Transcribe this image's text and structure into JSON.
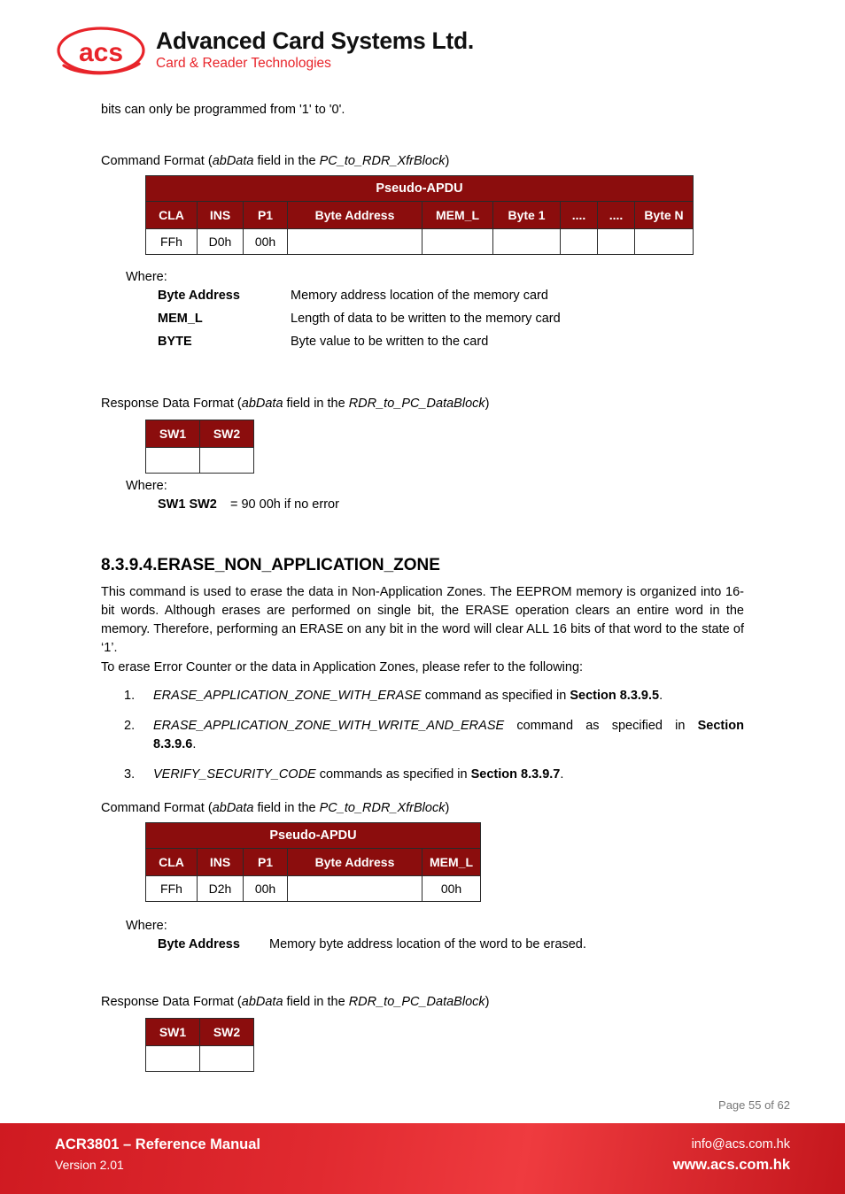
{
  "header": {
    "logo_icon": "acs-oval-logo-icon",
    "logo_wordmark": "acs",
    "company_name": "Advanced Card Systems Ltd.",
    "tagline": "Card & Reader Technologies"
  },
  "body": {
    "intro_line": "bits can only be programmed from '1' to '0'.",
    "command_format_caption_1": {
      "prefix": "Command Format (",
      "italic_1": "abData",
      "middle": " field in the ",
      "italic_2": "PC_to_RDR_XfrBlock",
      "suffix": ")"
    },
    "response_format_caption_1": {
      "prefix": "Response Data Format (",
      "italic_1": "abData",
      "middle": " field in the ",
      "italic_2": "RDR_to_PC_DataBlock",
      "suffix": ")"
    },
    "command_format_caption_2": {
      "prefix": "Command Format (",
      "italic_1": "abData",
      "middle": " field in the ",
      "italic_2": "PC_to_RDR_XfrBlock",
      "suffix": ")"
    },
    "response_format_caption_2": {
      "prefix": "Response Data Format (",
      "italic_1": "abData",
      "middle": " field in the ",
      "italic_2": "RDR_to_PC_DataBlock",
      "suffix": ")"
    },
    "where_label_1": "Where:",
    "where_label_2": "Where:",
    "where_label_3": "Where:",
    "definitions_1": [
      {
        "term": "Byte Address",
        "desc": "Memory address location of the memory card"
      },
      {
        "term": "MEM_L",
        "desc": "Length of data to be written to the memory card"
      },
      {
        "term": "BYTE",
        "desc": "Byte value to be written to the card"
      }
    ],
    "definitions_2": [
      {
        "term": "SW1 SW2",
        "desc": "= 90 00h if no error"
      }
    ],
    "definitions_3": [
      {
        "term": "Byte Address",
        "desc": "Memory byte address location of the word to be erased."
      }
    ],
    "section": {
      "number": "8.3.9.4.",
      "title": "ERASE_NON_APPLICATION_ZONE"
    },
    "paragraph_1": "This command is used to erase the data in Non-Application Zones. The EEPROM memory is organized into 16-bit words. Although erases are performed on single bit, the ERASE operation clears an entire word in the memory. Therefore, performing an ERASE on any bit in the word will clear ALL 16 bits of that word to the state of ‘1’.",
    "paragraph_2": "To erase Error Counter or the data in Application Zones, please refer to the following:",
    "ref_list": [
      {
        "num": "1.",
        "italic": "ERASE_APPLICATION_ZONE_WITH_ERASE",
        "mid": " command as specified in ",
        "bold": "Section 8.3.9.5",
        "end": "."
      },
      {
        "num": "2.",
        "italic": "ERASE_APPLICATION_ZONE_WITH_WRITE_AND_ERASE",
        "mid": "  command as specified in ",
        "bold": "Section 8.3.9.6",
        "end": "."
      },
      {
        "num": "3.",
        "italic": "VERIFY_SECURITY_CODE",
        "mid": " commands as specified in ",
        "bold": "Section 8.3.9.7",
        "end": "."
      }
    ]
  },
  "tables": {
    "apdu_write": {
      "title": "Pseudo-APDU",
      "headers": [
        "CLA",
        "INS",
        "P1",
        "Byte Address",
        "MEM_L",
        "Byte 1",
        "....",
        "....",
        "Byte N"
      ],
      "values": [
        "FFh",
        "D0h",
        "00h",
        "",
        "",
        "",
        "",
        "",
        ""
      ]
    },
    "sw_table_1": {
      "headers": [
        "SW1",
        "SW2"
      ],
      "values": [
        "",
        ""
      ]
    },
    "apdu_erase": {
      "title": "Pseudo-APDU",
      "headers": [
        "CLA",
        "INS",
        "P1",
        "Byte Address",
        "MEM_L"
      ],
      "values": [
        "FFh",
        "D2h",
        "00h",
        "",
        "00h"
      ]
    },
    "sw_table_2": {
      "headers": [
        "SW1",
        "SW2"
      ],
      "values": [
        "",
        ""
      ]
    }
  },
  "footer": {
    "page_number": "Page 55 of 62",
    "doc_title": "ACR3801 – Reference Manual",
    "version": "Version 2.01",
    "email": "info@acs.com.hk",
    "website": "www.acs.com.hk"
  },
  "colors": {
    "table_header_red": "#8b0d0d",
    "brand_red": "#e8242a",
    "footer_red": "#e12a30",
    "page_number_gray": "#777777"
  }
}
